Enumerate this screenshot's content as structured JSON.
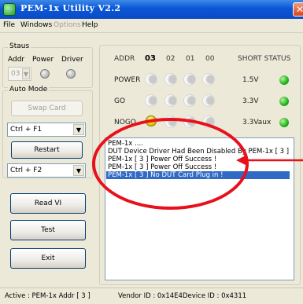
{
  "window": {
    "title": "PEM-1x  Utility V2.2",
    "close_glyph": "✕"
  },
  "menu": {
    "items": [
      {
        "label": "File",
        "enabled": true
      },
      {
        "label": "Windows",
        "enabled": true
      },
      {
        "label": "Options",
        "enabled": false
      },
      {
        "label": "Help",
        "enabled": true
      }
    ]
  },
  "status_group": {
    "label": "Staus",
    "addr_label": "Addr",
    "power_label": "Power",
    "driver_label": "Driver",
    "addr_value": "03"
  },
  "auto_mode": {
    "label": "Auto Mode",
    "swap_card": "Swap Card",
    "hotkey1": "Ctrl + F1",
    "restart": "Restart",
    "hotkey2": "Ctrl + F2"
  },
  "actions": {
    "read_vi": "Read VI",
    "test": "Test",
    "exit": "Exit"
  },
  "grid": {
    "addr_header": "ADDR",
    "addresses": [
      "03",
      "02",
      "01",
      "00"
    ],
    "short_status_header": "SHORT STATUS",
    "rows": [
      {
        "label": "POWER",
        "rail": "1.5V"
      },
      {
        "label": "GO",
        "rail": "3.3V"
      },
      {
        "label": "NOGO",
        "rail": "3.3Vaux"
      }
    ]
  },
  "log": {
    "lines": [
      "PEM-1x ....",
      "DUT Device Driver Had Been Disabled By PEM-1x [ 3 ]",
      "PEM-1x [ 3 ] Power Off Success !",
      "PEM-1x [ 3 ] Power Off Success !",
      "PEM-1x [ 3 ] No DUT Card Plug in !"
    ],
    "selected_index": 4
  },
  "statusbar": {
    "active": "Active :  PEM-1x Addr [ 3 ]",
    "vendor": "Vendor ID : 0x14E4",
    "device": "Device ID : 0x4311"
  },
  "colors": {
    "accent_blue": "#316ac5",
    "annotation_red": "#e8101c",
    "led_green": "#21b11a",
    "led_yellow": "#e8d100"
  }
}
